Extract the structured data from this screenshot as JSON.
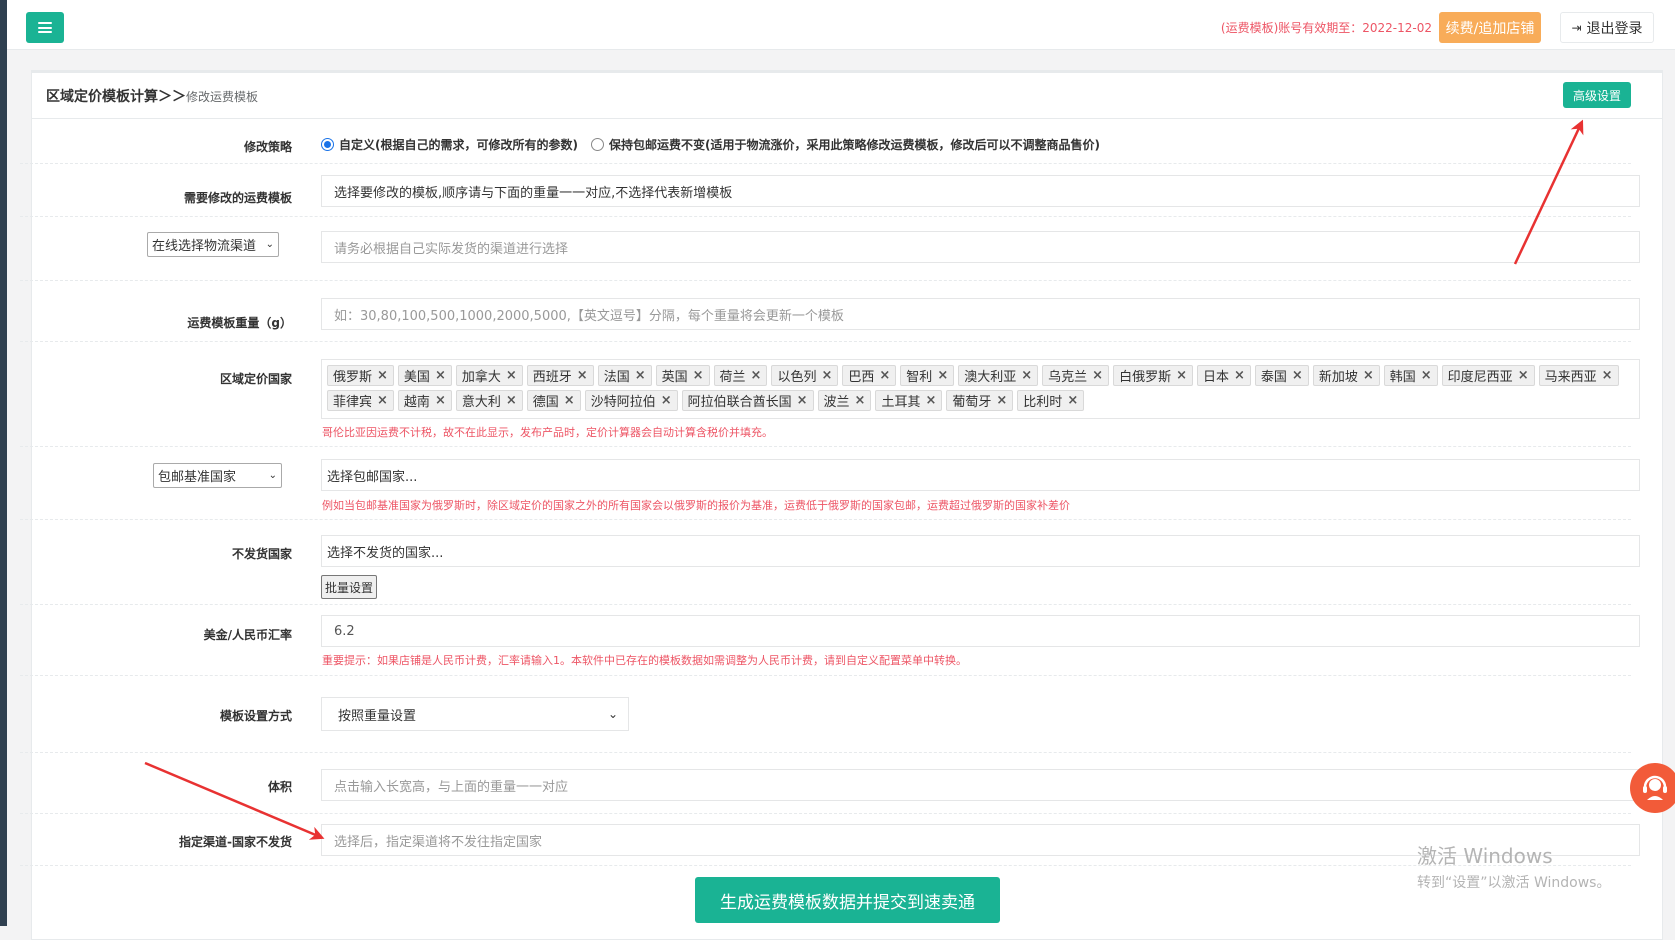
{
  "topbar": {
    "expire_text": "(运费模板)账号有效期至：2022-12-02",
    "renew_label": "续费/追加店铺",
    "logout_label": "退出登录"
  },
  "breadcrumb": {
    "main": "区域定价模板计算＞＞",
    "sub": "修改运费模板"
  },
  "advanced_label": "高级设置",
  "form": {
    "strategy": {
      "label": "修改策略",
      "option1": "自定义(根据自己的需求，可修改所有的参数)",
      "option2": "保持包邮运费不变(适用于物流涨价，采用此策略修改运费模板，修改后可以不调整商品售价)",
      "selected": "option1"
    },
    "template": {
      "label": "需要修改的运费模板",
      "value": "选择要修改的模板,顺序请与下面的重量一一对应,不选择代表新增模板"
    },
    "channel": {
      "select_label": "在线选择物流渠道",
      "placeholder": "请务必根据自己实际发货的渠道进行选择"
    },
    "weight": {
      "label": "运费模板重量（g）",
      "placeholder": "如：30,80,100,500,1000,2000,5000,【英文逗号】分隔，每个重量将会更新一个模板"
    },
    "regions": {
      "label": "区域定价国家",
      "tags": [
        "俄罗斯",
        "美国",
        "加拿大",
        "西班牙",
        "法国",
        "英国",
        "荷兰",
        "以色列",
        "巴西",
        "智利",
        "澳大利亚",
        "乌克兰",
        "白俄罗斯",
        "日本",
        "泰国",
        "新加坡",
        "韩国",
        "印度尼西亚",
        "马来西亚",
        "菲律宾",
        "越南",
        "意大利",
        "德国",
        "沙特阿拉伯",
        "阿拉伯联合酋长国",
        "波兰",
        "土耳其",
        "葡萄牙",
        "比利时"
      ],
      "hint": "哥伦比亚因运费不计税，故不在此显示，发布产品时，定价计算器会自动计算含税价并填充。"
    },
    "free_ship": {
      "select_label": "包邮基准国家",
      "placeholder": "选择包邮国家...",
      "hint": "例如当包邮基准国家为俄罗斯时，除区域定价的国家之外的所有国家会以俄罗斯的报价为基准，运费低于俄罗斯的国家包邮，运费超过俄罗斯的国家补差价"
    },
    "no_ship": {
      "label": "不发货国家",
      "placeholder": "选择不发货的国家...",
      "batch_label": "批量设置"
    },
    "rate": {
      "label": "美金/人民币汇率",
      "value": "6.2",
      "hint": "重要提示：如果店铺是人民币计费，汇率请输入1。本软件中已存在的模板数据如需调整为人民币计费，请到自定义配置菜单中转换。"
    },
    "method": {
      "label": "模板设置方式",
      "value": "按照重量设置"
    },
    "volume": {
      "label": "体积",
      "placeholder": "点击输入长宽高，与上面的重量一一对应"
    },
    "channel_block": {
      "label": "指定渠道-国家不发货",
      "placeholder": "选择后，指定渠道将不发往指定国家"
    }
  },
  "submit_label": "生成运费模板数据并提交到速卖通",
  "watermark": {
    "line1": "激活 Windows",
    "line2": "转到“设置”以激活 Windows。"
  },
  "colors": {
    "primary": "#1ab394",
    "warning": "#f8ac59",
    "danger": "#ed5565",
    "arrow": "#e83232"
  },
  "icons": {
    "menu": "menu-icon",
    "logout": "sign-out-icon",
    "support": "headset-icon"
  }
}
